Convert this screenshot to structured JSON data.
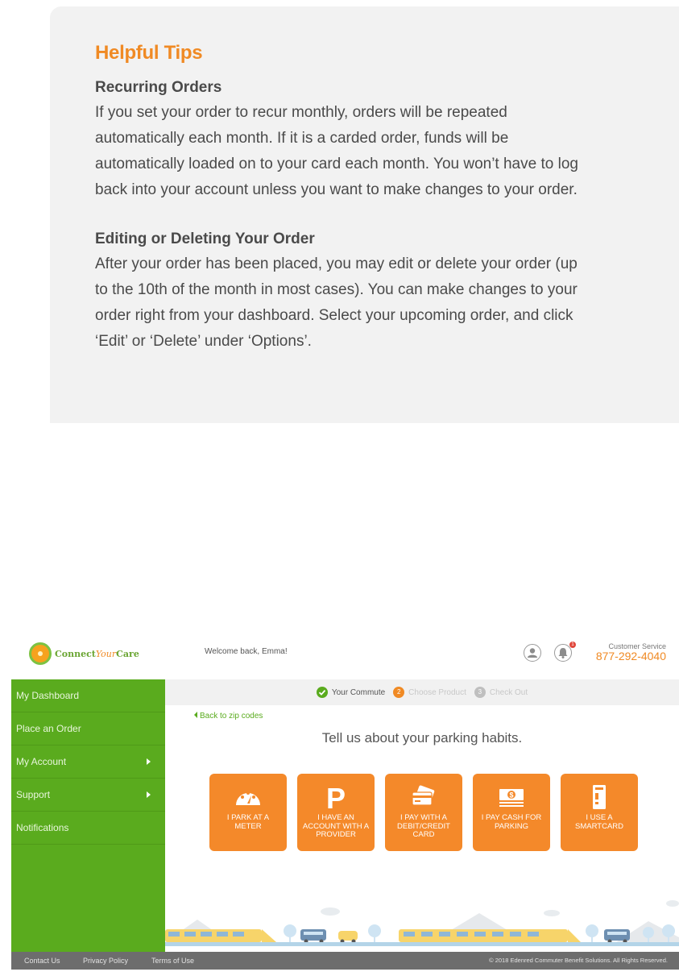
{
  "tips": {
    "title": "Helpful Tips",
    "sections": [
      {
        "heading": "Recurring Orders",
        "body": "If you set your order to recur monthly, orders will be repeated automatically each month. If it is a carded order, funds will be automatically loaded on to your card each month. You won’t have to log back into your account unless you want to make changes to your order."
      },
      {
        "heading": "Editing or Deleting Your Order",
        "body": "After your order has been placed, you may edit or delete your order (up to the 10th of the month in most cases). You can make changes to your order right from your dashboard. Select your upcoming order, and click ‘Edit’ or ‘Delete’ under ‘Options’."
      }
    ]
  },
  "header": {
    "logo_connect": "Connect",
    "logo_your": "Your",
    "logo_care": "Care",
    "welcome": "Welcome back, Emma!",
    "notification_count": "1",
    "customer_service_label": "Customer Service",
    "customer_service_phone": "877-292-4040"
  },
  "sidebar": {
    "items": [
      {
        "label": "My Dashboard",
        "has_submenu": false
      },
      {
        "label": "Place an Order",
        "has_submenu": false
      },
      {
        "label": "My Account",
        "has_submenu": true
      },
      {
        "label": "Support",
        "has_submenu": true
      },
      {
        "label": "Notifications",
        "has_submenu": false
      }
    ]
  },
  "stepper": {
    "steps": [
      {
        "number": "1",
        "label": "Your Commute",
        "state": "done"
      },
      {
        "number": "2",
        "label": "Choose Product",
        "state": "current"
      },
      {
        "number": "3",
        "label": "Check Out",
        "state": "todo"
      }
    ]
  },
  "main": {
    "back_link": "Back to zip codes",
    "headline": "Tell us about your parking habits.",
    "options": [
      {
        "label": "I PARK AT A METER",
        "icon": "parking-meter-icon"
      },
      {
        "label": "I HAVE AN ACCOUNT WITH A PROVIDER",
        "icon": "parking-p-icon"
      },
      {
        "label": "I PAY WITH A DEBIT/CREDIT CARD",
        "icon": "credit-card-icon"
      },
      {
        "label": "I PAY CASH FOR PARKING",
        "icon": "cash-icon"
      },
      {
        "label": "I USE A SMARTCARD",
        "icon": "smartcard-icon"
      }
    ]
  },
  "footer": {
    "links": [
      "Contact Us",
      "Privacy Policy",
      "Terms of Use"
    ],
    "copyright": "© 2018 Edenred Commuter Benefit Solutions. All Rights Reserved."
  },
  "colors": {
    "accent_orange": "#f08a24",
    "sidebar_green": "#5aab1e",
    "footer_gray": "#6d6d6d",
    "panel_gray": "#f2f2f2"
  }
}
